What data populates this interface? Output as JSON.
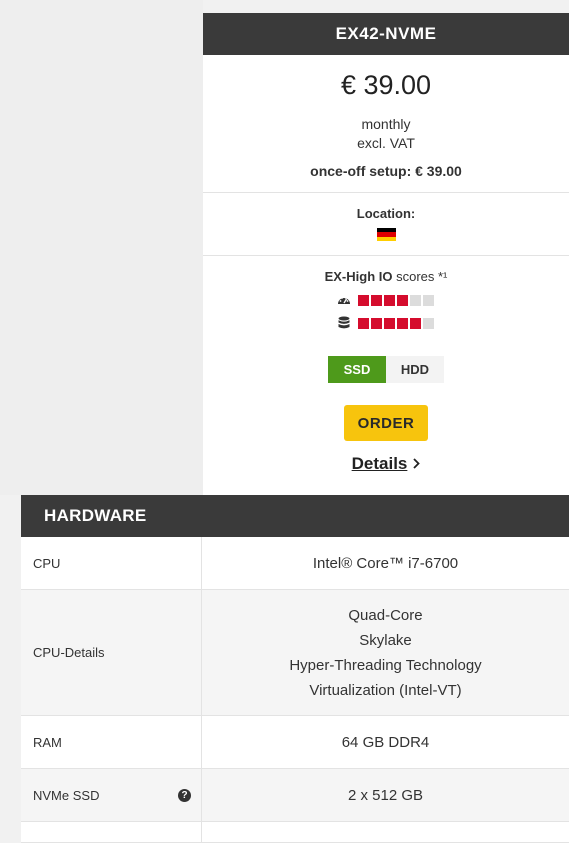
{
  "product": {
    "name": "EX42-NVME",
    "price": "€ 39.00",
    "period": "monthly",
    "vat": "excl. VAT",
    "setup": "once-off setup: € 39.00"
  },
  "location": {
    "label": "Location:",
    "flag": "germany-flag"
  },
  "io_scores": {
    "title_bold": "EX-High IO",
    "title_rest": " scores *¹",
    "rows": [
      {
        "icon": "speedometer-icon",
        "level": 4,
        "max": 6
      },
      {
        "icon": "database-icon",
        "level": 5,
        "max": 6
      }
    ]
  },
  "storage_toggle": {
    "options": [
      "SSD",
      "HDD"
    ],
    "selected": "SSD"
  },
  "actions": {
    "order_label": "ORDER",
    "details_label": "Details"
  },
  "hardware": {
    "title": "HARDWARE",
    "rows": [
      {
        "label": "CPU",
        "values": [
          "Intel® Core™ i7-6700"
        ]
      },
      {
        "label": "CPU-Details",
        "values": [
          "Quad-Core",
          "Skylake",
          "Hyper-Threading Technology",
          "Virtualization (Intel-VT)"
        ]
      },
      {
        "label": "RAM",
        "values": [
          "64 GB DDR4"
        ]
      },
      {
        "label": "NVMe SSD",
        "values": [
          "2 x 512 GB"
        ],
        "help": true
      }
    ]
  },
  "colors": {
    "header_bg": "#3a3a3a",
    "score_on": "#d50c2d",
    "score_off": "#dcdcdc",
    "ssd_active": "#4e9a1b",
    "order_bg": "#f7c40d"
  }
}
